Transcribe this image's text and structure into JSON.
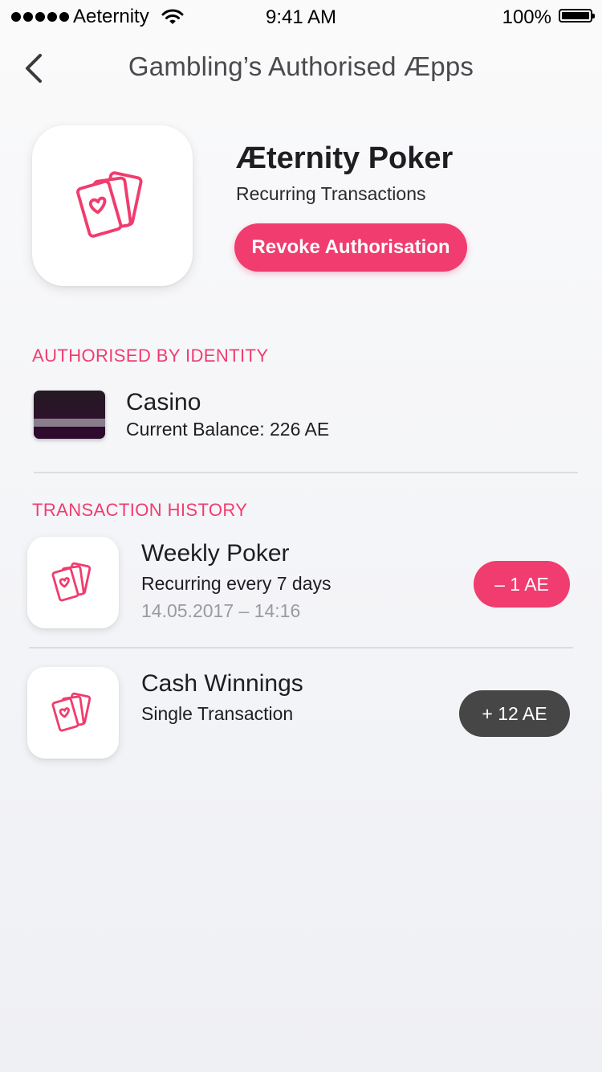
{
  "status_bar": {
    "carrier": "Aeternity",
    "time": "9:41 AM",
    "battery": "100%",
    "battery_level": 1.0
  },
  "nav": {
    "title": "Gambling’s Authorised Æpps",
    "back_icon": "chevron-left-icon"
  },
  "app": {
    "name": "Æternity Poker",
    "subtitle": "Recurring Transactions",
    "icon": "playing-cards-icon",
    "revoke_label": "Revoke Authorisation"
  },
  "identity": {
    "heading": "AUTHORISED BY IDENTITY",
    "name": "Casino",
    "balance": "Current Balance: 226 AE"
  },
  "history": {
    "heading": "TRANSACTION HISTORY",
    "items": [
      {
        "title": "Weekly Poker",
        "subtitle": "Recurring every 7 days",
        "date": "14.05.2017 – 14:16",
        "amount": "– 1 AE",
        "type": "debit"
      },
      {
        "title": "Cash Winnings",
        "subtitle": "Single Transaction",
        "amount": "+ 12 AE",
        "type": "credit"
      }
    ]
  },
  "colors": {
    "accent": "#f03c6e",
    "credit_pill": "#464646",
    "text": "#1e1e22",
    "muted": "#9a9aa0"
  }
}
